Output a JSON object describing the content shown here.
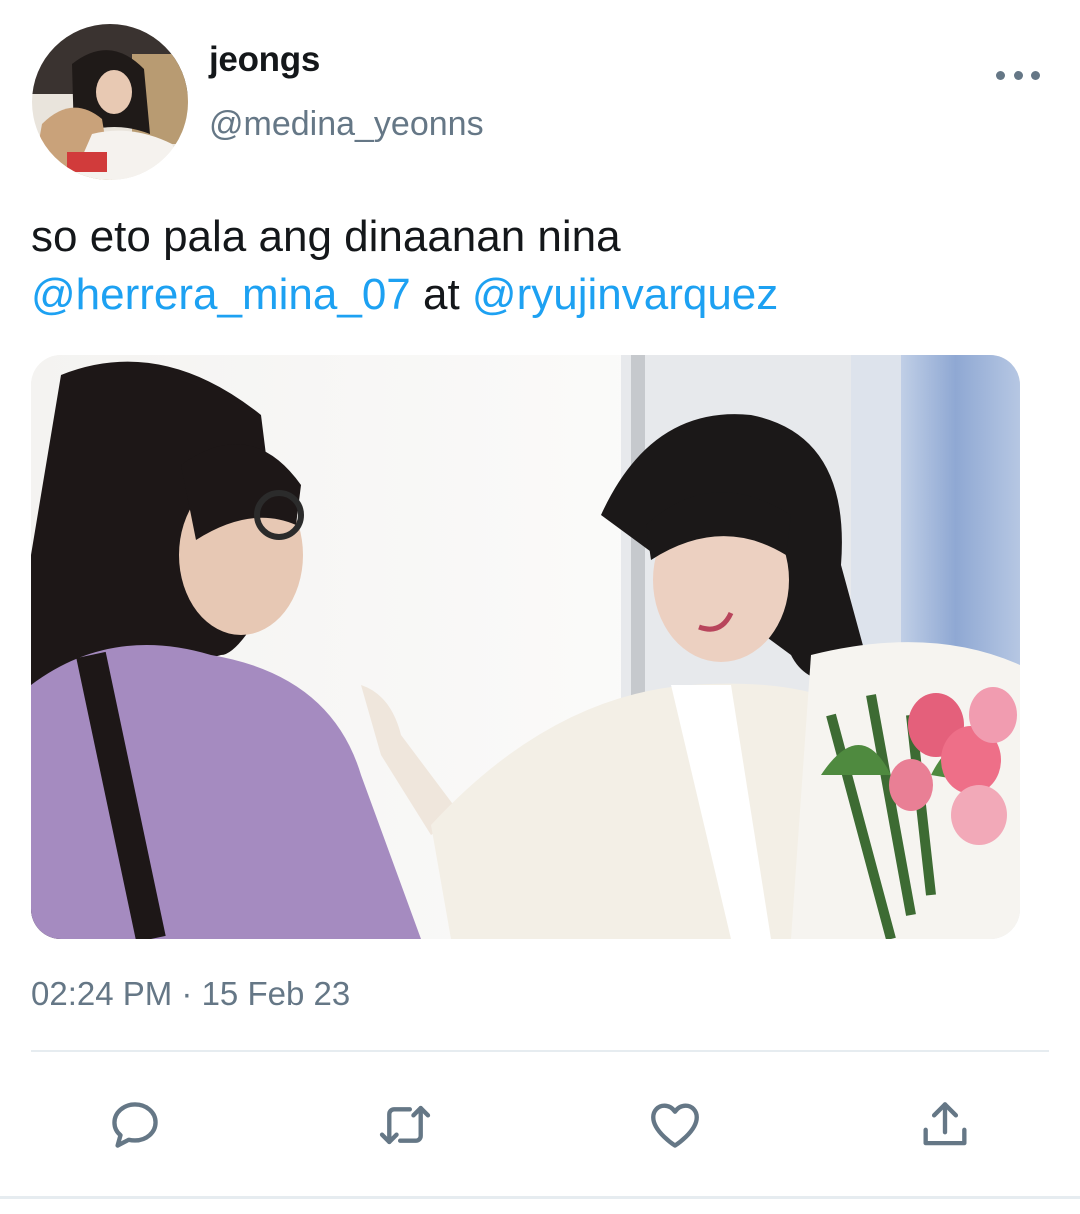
{
  "tweet": {
    "display_name": "jeongs",
    "handle": "@medina_yeonns",
    "text_part1": "so eto pala ang dinaanan nina",
    "mention1": "@herrera_mina_07",
    "text_part2": " at ",
    "mention2": "@ryujinvarquez",
    "timestamp": "02:24 PM · 15 Feb 23"
  },
  "icons": {
    "more": "more-options-icon",
    "reply": "reply-icon",
    "retweet": "retweet-icon",
    "like": "like-icon",
    "share": "share-icon"
  },
  "colors": {
    "accent": "#1da1f2",
    "secondary_text": "#657786",
    "primary_text": "#14171a",
    "divider": "#e6ecf0"
  }
}
